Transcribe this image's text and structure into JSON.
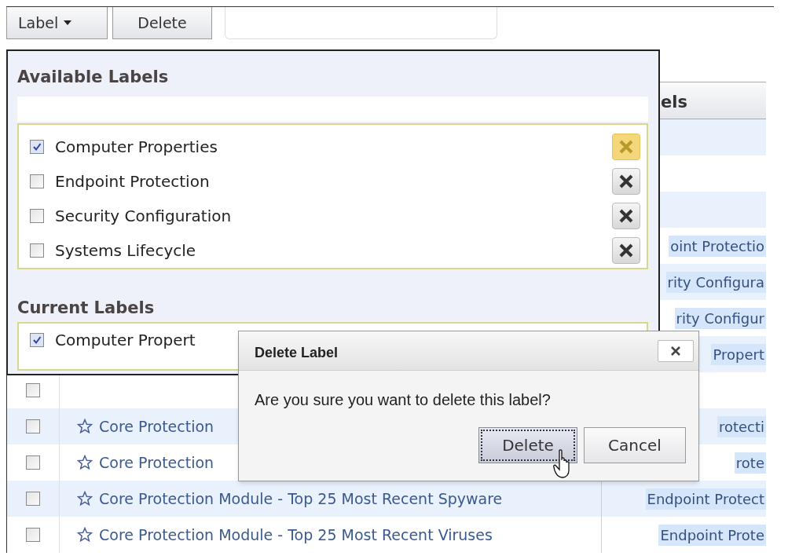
{
  "toolbar": {
    "buttons": [
      {
        "label": "Label",
        "kind": "menu"
      },
      {
        "label": "Delete",
        "kind": "plain"
      }
    ]
  },
  "table": {
    "header_fragment": "els",
    "rows": [
      {},
      {},
      {},
      {
        "labels": "oint Protectio"
      },
      {
        "labels": "rity Configura"
      },
      {
        "labels": "rity Configur"
      },
      {
        "labels": "Propert"
      },
      {
        "checked": false
      },
      {
        "checked": false,
        "title": "Core Protection",
        "labels": "rotecti"
      },
      {
        "checked": false,
        "title": "Core Protection",
        "labels": "rote"
      },
      {
        "checked": false,
        "title": "Core Protection Module - Top 25 Most Recent Spyware",
        "labels": "Endpoint Protect"
      },
      {
        "checked": false,
        "title": "Core Protection Module - Top 25 Most Recent Viruses",
        "labels": "Endpoint Prote"
      }
    ]
  },
  "label_menu": {
    "available_title": "Available Labels",
    "available": [
      {
        "label": "Computer Properties",
        "checked": true,
        "hovered": true
      },
      {
        "label": "Endpoint Protection",
        "checked": false,
        "hovered": false
      },
      {
        "label": "Security Configuration",
        "checked": false,
        "hovered": false
      },
      {
        "label": "Systems Lifecycle",
        "checked": false,
        "hovered": false
      }
    ],
    "current_title": "Current Labels",
    "current": [
      {
        "label": "Computer Propert",
        "checked": true
      }
    ]
  },
  "dialog": {
    "title": "Delete Label",
    "message": "Are you sure you want to delete this label?",
    "buttons": [
      {
        "label": "Delete",
        "focused": true
      },
      {
        "label": "Cancel",
        "focused": false
      }
    ]
  }
}
